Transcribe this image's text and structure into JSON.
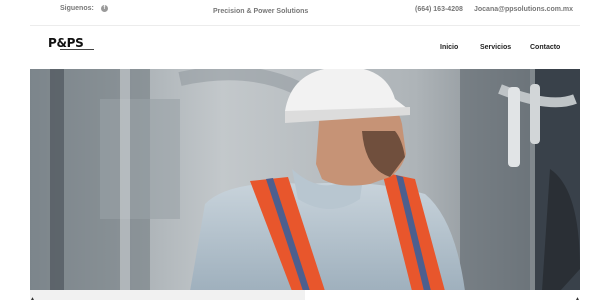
{
  "topbar": {
    "follow_label": "Siguenos:",
    "social_icon": "facebook-icon",
    "tagline": "Precision & Power Solutions",
    "phone": "(664) 163-4208",
    "email": "Jocana@ppsolutions.com.mx"
  },
  "header": {
    "logo_text": "P&PS"
  },
  "nav": {
    "items": [
      {
        "label": "Inicio"
      },
      {
        "label": "Servicios"
      },
      {
        "label": "Contacto"
      }
    ]
  },
  "hero": {
    "image_subject": "worker-with-hard-hat-and-safety-vest"
  },
  "colors": {
    "vest_orange": "#e8562c",
    "reflective_stripe": "#4d5f8e",
    "helmet_white": "#f2f2f2"
  }
}
